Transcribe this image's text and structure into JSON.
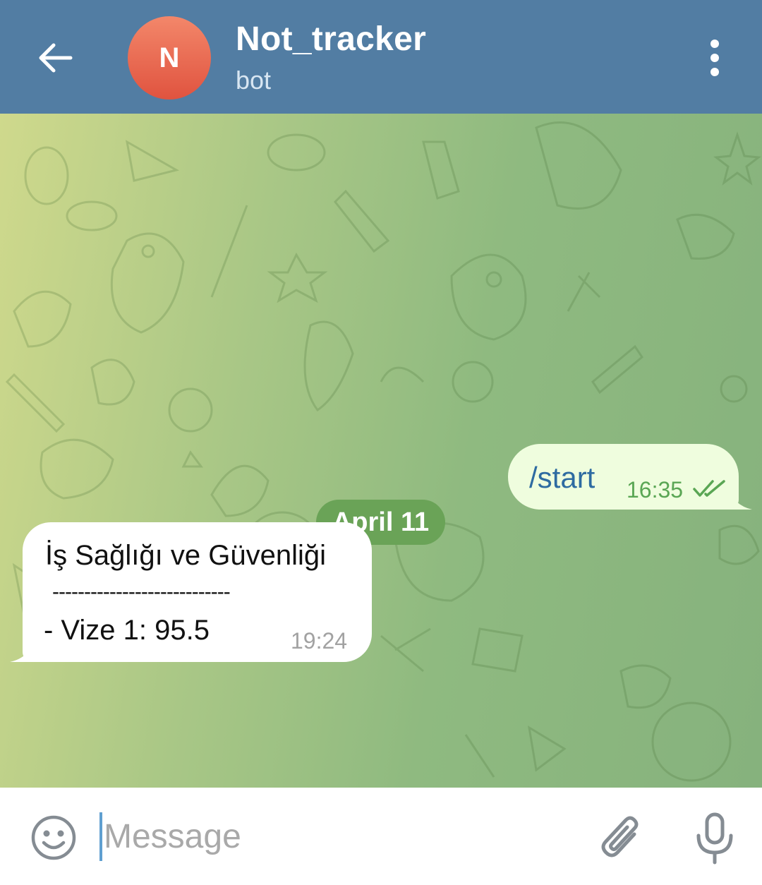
{
  "header": {
    "avatar_letter": "N",
    "title": "Not_tracker",
    "subtitle": "bot",
    "background_color": "#527da3",
    "avatar_color": "#e8624a",
    "icons": {
      "back": "arrow-left-icon",
      "menu": "more-vertical-icon"
    }
  },
  "chat": {
    "date_label": "April 11",
    "messages": [
      {
        "direction": "outgoing",
        "text": "/start",
        "time": "16:35",
        "status": "read"
      },
      {
        "direction": "incoming",
        "lines": [
          "İş Sağlığı ve Güvenliği",
          "----------------------------",
          "- Vize 1: 95.5"
        ],
        "time": "19:24"
      }
    ]
  },
  "input": {
    "placeholder": "Message",
    "icons": {
      "emoji": "emoji-icon",
      "attach": "paperclip-icon",
      "mic": "microphone-icon"
    }
  },
  "colors": {
    "outgoing_bubble": "#effdde",
    "incoming_bubble": "#ffffff",
    "date_pill": "#6aa357",
    "time_outgoing": "#5aa654"
  }
}
